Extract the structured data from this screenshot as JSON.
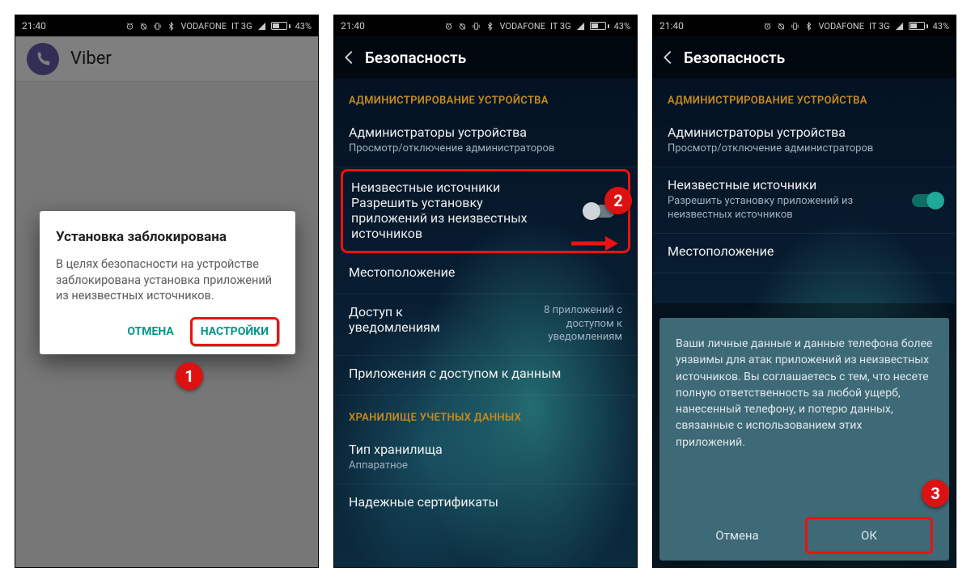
{
  "statusbar": {
    "time": "21:40",
    "carrier": "VODAFONE",
    "network": "IT 3G",
    "battery": "43%"
  },
  "p1": {
    "app_title": "Viber",
    "dialog": {
      "title": "Установка заблокирована",
      "body": "В целях безопасности на устройстве заблокирована установка приложений из неизвестных источников.",
      "cancel": "ОТМЕНА",
      "settings": "НАСТРОЙКИ"
    }
  },
  "security": {
    "title": "Безопасность",
    "section_admin": "АДМИНИСТРИРОВАНИЕ УСТРОЙСТВА",
    "admins": {
      "primary": "Администраторы устройства",
      "secondary": "Просмотр/отключение администраторов"
    },
    "unknown": {
      "primary": "Неизвестные источники",
      "secondary": "Разрешить установку приложений из неизвестных источников"
    },
    "location": "Местоположение",
    "notif": {
      "primary": "Доступ к уведомлениям",
      "right": "8 приложений с доступом к уведомлениям"
    },
    "appdata": "Приложения с доступом к данным",
    "section_cred": "ХРАНИЛИЩЕ УЧЕТНЫХ ДАННЫХ",
    "storage": {
      "primary": "Тип хранилища",
      "secondary": "Аппаратное"
    },
    "trusted": "Надежные сертификаты"
  },
  "p3sheet": {
    "body": "Ваши личные данные и данные телефона более уязвимы для атак приложений из неизвестных источников. Вы соглашаетесь с тем, что несете полную ответственность за любой ущерб, нанесенный телефону, и потерю данных, связанные с использованием этих приложений.",
    "cancel": "Отмена",
    "ok": "ОК"
  },
  "steps": {
    "s1": "1",
    "s2": "2",
    "s3": "3"
  }
}
